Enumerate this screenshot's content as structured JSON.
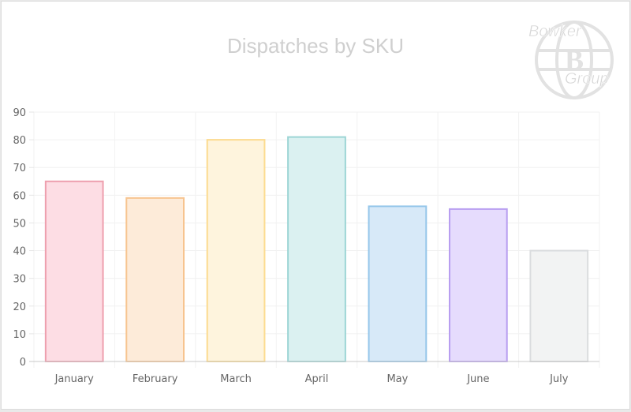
{
  "chart_data": {
    "type": "bar",
    "title": "Dispatches by SKU",
    "xlabel": "",
    "ylabel": "",
    "categories": [
      "January",
      "February",
      "March",
      "April",
      "May",
      "June",
      "July"
    ],
    "values": [
      65,
      59,
      80,
      81,
      56,
      55,
      40
    ],
    "ylim": [
      0,
      90
    ],
    "yticks": [
      0,
      10,
      20,
      30,
      40,
      50,
      60,
      70,
      80,
      90
    ],
    "grid": true,
    "legend": "none",
    "colors": {
      "fills": [
        "#fddde4",
        "#fdebd9",
        "#fef4dd",
        "#dbf1f1",
        "#d7e9f8",
        "#e6dcfd",
        "#f2f3f3"
      ],
      "borders": [
        "#ee9fae",
        "#f7c48f",
        "#fcdb8f",
        "#9cd5d5",
        "#95c6ea",
        "#b89ef0",
        "#dadcde"
      ]
    }
  },
  "logo": {
    "line1": "Bowker",
    "line2": "Group",
    "mark": "B"
  }
}
